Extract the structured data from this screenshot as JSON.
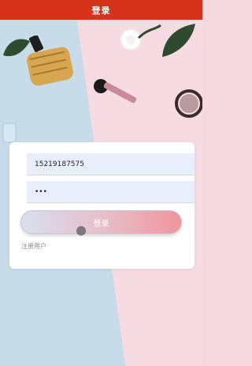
{
  "header": {
    "title": "登录"
  },
  "form": {
    "phone_value": "15219187575",
    "password_value": "•••",
    "login_label": "登录",
    "register_label": "注册用户"
  },
  "colors": {
    "header": "#d5331c",
    "bg_pink": "#f6dbe2",
    "bg_blue": "#c8dbe8",
    "field_bg": "#e8eefc",
    "button_gradient": [
      "#d9dff0",
      "#f0959c"
    ]
  },
  "icons": [
    "perfume-bottle-icon",
    "rose-icon",
    "makeup-brush-icon",
    "lipstick-icon",
    "sunglasses-icon",
    "leaf-icon"
  ]
}
